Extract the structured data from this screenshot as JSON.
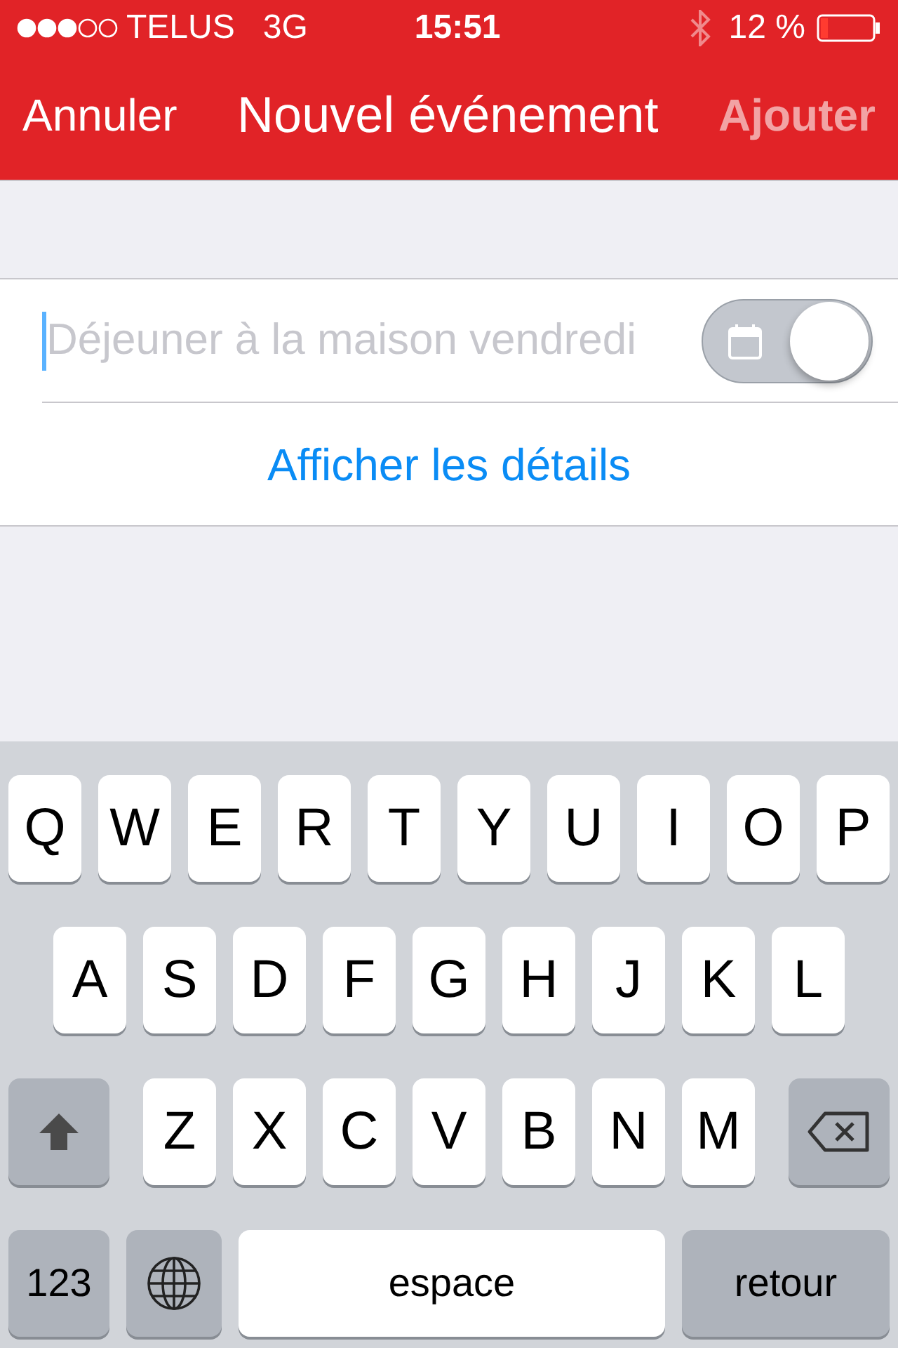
{
  "status_bar": {
    "carrier": "TELUS",
    "network": "3G",
    "time": "15:51",
    "battery_text": "12 %"
  },
  "nav_bar": {
    "cancel": "Annuler",
    "title": "Nouvel événement",
    "add": {
      "label": "Ajouter",
      "disabled": true
    }
  },
  "event_field": {
    "placeholder": "Déjeuner à la maison vendredi",
    "toggle": {
      "on": false
    }
  },
  "details_link": "Afficher les détails",
  "keyboard": {
    "key_rows": [
      {
        "keys": [
          {
            "kind": "letter",
            "label": "Q"
          },
          {
            "kind": "letter",
            "label": "W"
          },
          {
            "kind": "letter",
            "label": "E"
          },
          {
            "kind": "letter",
            "label": "R"
          },
          {
            "kind": "letter",
            "label": "T"
          },
          {
            "kind": "letter",
            "label": "Y"
          },
          {
            "kind": "letter",
            "label": "U"
          },
          {
            "kind": "letter",
            "label": "I"
          },
          {
            "kind": "letter",
            "label": "O"
          },
          {
            "kind": "letter",
            "label": "P"
          }
        ]
      },
      {
        "keys": [
          {
            "kind": "letter",
            "label": "A"
          },
          {
            "kind": "letter",
            "label": "S"
          },
          {
            "kind": "letter",
            "label": "D"
          },
          {
            "kind": "letter",
            "label": "F"
          },
          {
            "kind": "letter",
            "label": "G"
          },
          {
            "kind": "letter",
            "label": "H"
          },
          {
            "kind": "letter",
            "label": "J"
          },
          {
            "kind": "letter",
            "label": "K"
          },
          {
            "kind": "letter",
            "label": "L"
          }
        ]
      },
      {
        "keys": [
          {
            "kind": "shift"
          },
          {
            "kind": "letter",
            "label": "Z"
          },
          {
            "kind": "letter",
            "label": "X"
          },
          {
            "kind": "letter",
            "label": "C"
          },
          {
            "kind": "letter",
            "label": "V"
          },
          {
            "kind": "letter",
            "label": "B"
          },
          {
            "kind": "letter",
            "label": "N"
          },
          {
            "kind": "letter",
            "label": "M"
          },
          {
            "kind": "delete"
          }
        ]
      },
      {
        "keys": [
          {
            "kind": "mode",
            "label": "123"
          },
          {
            "kind": "globe"
          },
          {
            "kind": "space",
            "label": "espace"
          },
          {
            "kind": "return",
            "label": "retour"
          }
        ]
      }
    ]
  }
}
